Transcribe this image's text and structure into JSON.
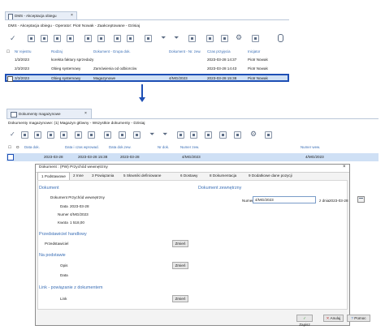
{
  "top": {
    "tab_label": "DMS - Akceptacja obiegu",
    "breadcrumb": "DMS - Akceptacja obiegu - Operator: Piotr Nowak - Zaakceptowane - Dzisiaj",
    "columns": [
      "Nr rejestru",
      "Rodzaj",
      "Dokument - Grupa dok.",
      "Dokument - Nr. zew.",
      "Czas przyjęcia",
      "Inicjator"
    ],
    "rows": [
      {
        "nr": "1/3/2023",
        "rodzaj": "korekta faktury sprzedaży",
        "grupa": "",
        "nrzew": "",
        "czas": "2023-03-28 14:37",
        "inicjator": "Piotr Nowak"
      },
      {
        "nr": "2/3/2023",
        "rodzaj": "Obieg systemowy",
        "grupa": "Zamówienia od odbiorców",
        "nrzew": "",
        "czas": "2023-03-28 14:43",
        "inicjator": "Piotr Nowak"
      },
      {
        "nr": "3/3/2023",
        "rodzaj": "Obieg systemowy",
        "grupa": "Magazynowe",
        "nrzew": "4/MG/2023",
        "czas": "2023-03-28 15:38",
        "inicjator": "Piotr Nowak"
      }
    ]
  },
  "mid": {
    "tab_label": "Dokumenty magazynowe",
    "breadcrumb": "Dokumenty magazynowe: (1) Magazyn główny - Wszystkie dokumenty - Dzisiaj",
    "columns": [
      "Data dok.",
      "Data i czas wprowad.",
      "Data dok.zew.",
      "Nr dok.",
      "Numer zew.",
      "Numer wew."
    ],
    "row": {
      "data": "2023-03-28",
      "czas": "2023-03-28 15:38",
      "datazew": "2023-03-28",
      "nrdok": "",
      "numzew": "4/MG/2023",
      "numwew": "4/MG/2023"
    }
  },
  "dialog": {
    "title": "Dokument : (PW) Przychód wewnętrzny",
    "tabs": [
      "1 Podstawowe",
      "2 Inne",
      "3 Powiązania",
      "5 Słowniki definiowane",
      "6 Dostawy",
      "8 Dokumentacja",
      "9 Dodatkowe dane pozycji"
    ],
    "dokument_heading": "Dokument",
    "dokument_type": "Dokument Przychód wewnętrzny",
    "data_label": "Data",
    "data_value": "2023-03-28",
    "numer_label": "Numer",
    "numer_value": "4/MG/2023",
    "kwota_label": "Kwota",
    "kwota_value": "1 518,00",
    "zew_heading": "Dokument zewnętrzny",
    "zew_numer_label": "Numer",
    "zew_numer_value": "4/MG/2023",
    "zew_z_dnia_label": "z dnia",
    "zew_z_dnia_value": "2023-03-28",
    "handlowy_heading": "Przedstawiciel handlowy",
    "przedstawiciel_label": "Przedstawiciel",
    "zmien_label": "Zmień",
    "podstawie_heading": "Na podstawie",
    "opis_label": "Opis",
    "link_heading": "Link - powiązanie z dokumentem",
    "link_label": "Link",
    "zapisz": "Zapisz",
    "anuluj": "Anuluj",
    "pomoc": "Pomoc"
  },
  "colors": {
    "accent": "#3b6fb6",
    "selection": "#1e4fb5",
    "selected_row_bg": "#cfe0f5"
  }
}
